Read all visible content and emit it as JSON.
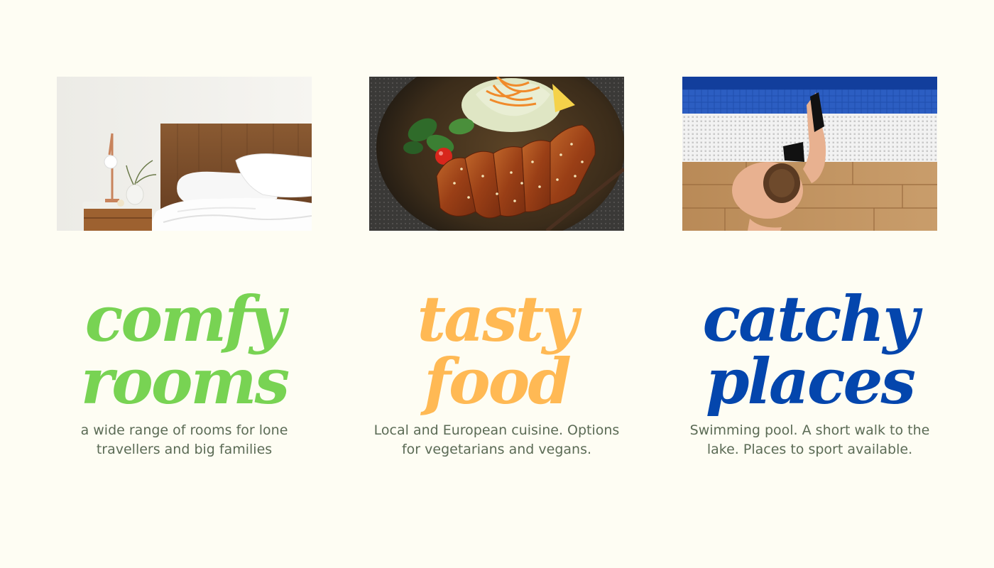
{
  "colors": {
    "background": "#fefdf3",
    "rooms_accent": "#78d353",
    "food_accent": "#ffb954",
    "places_accent": "#0446ad",
    "description_text": "#5b6b55"
  },
  "features": [
    {
      "image_icon": "bedroom-photo",
      "headline_line1": "comfy",
      "headline_line2": "rooms",
      "description": "a wide range of rooms for lone travellers and big families"
    },
    {
      "image_icon": "food-photo",
      "headline_line1": "tasty",
      "headline_line2": "food",
      "description": "Local and European cuisine. Options for vegetarians and vegans."
    },
    {
      "image_icon": "pool-photo",
      "headline_line1": "catchy",
      "headline_line2": "places",
      "description": "Swimming pool. A short walk to the lake. Places to sport available."
    }
  ]
}
